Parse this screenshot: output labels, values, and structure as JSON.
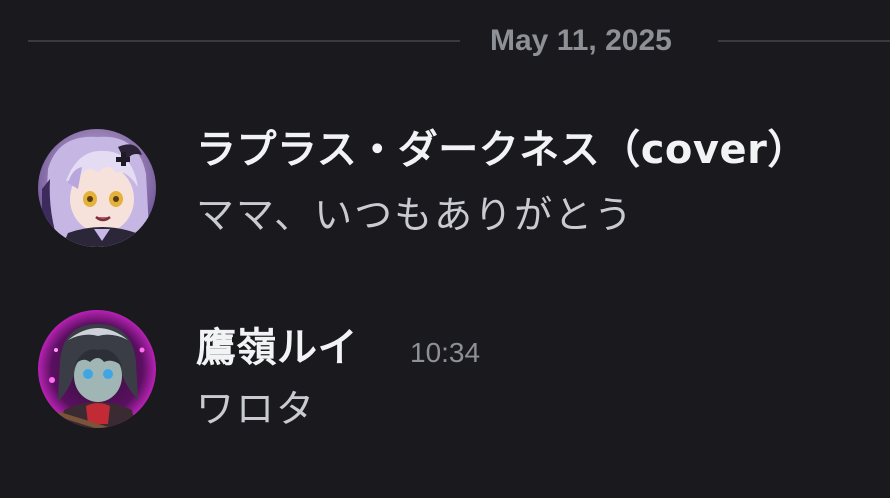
{
  "date_divider": {
    "label": "May 11, 2025"
  },
  "messages": [
    {
      "author": "ラプラス・ダークネス（cover）",
      "timestamp": "",
      "text": "ママ、いつもありがとう",
      "avatar_icon": "anime-character-avatar-purple-hair"
    },
    {
      "author": "鷹嶺ルイ",
      "timestamp": "10:34",
      "text": "ワロタ",
      "avatar_icon": "anime-character-avatar-dark-hair-pink-glow"
    }
  ],
  "colors": {
    "background": "#1a1a1e",
    "username": "#f2f3f5",
    "message_text": "#c9cbd0",
    "muted": "#8e9097",
    "divider_line": "#3a3b40"
  }
}
